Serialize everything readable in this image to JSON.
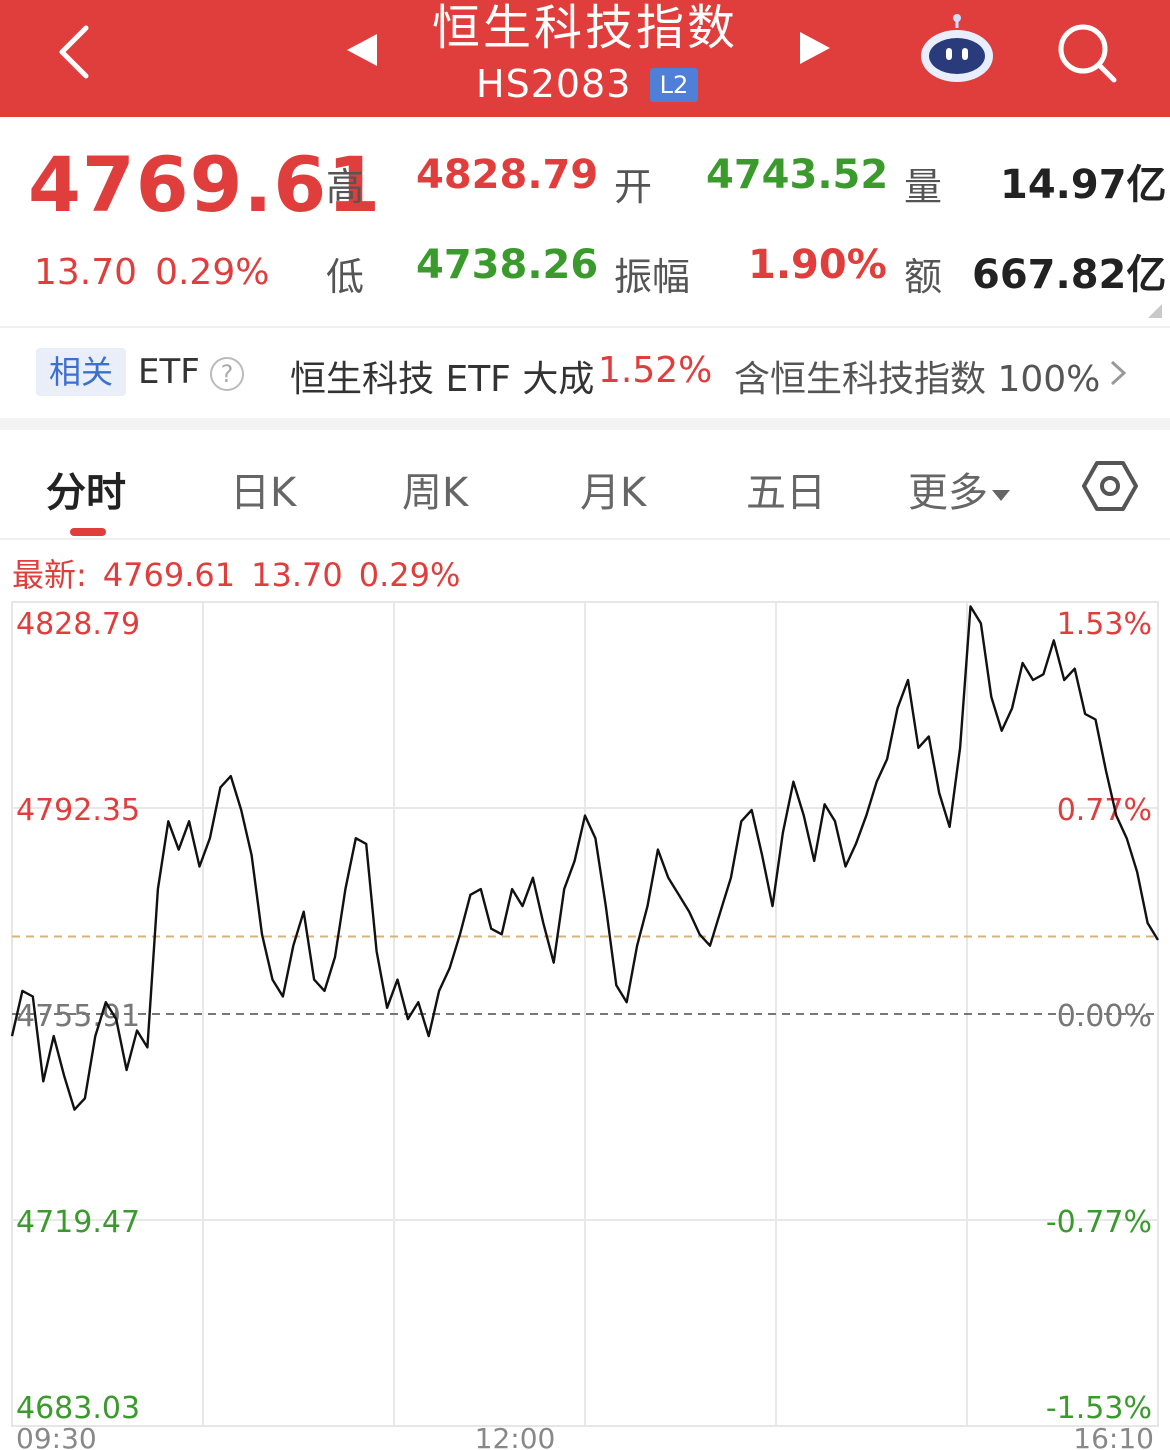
{
  "header": {
    "title": "恒生科技指数",
    "code": "HS2083",
    "level_badge": "L2"
  },
  "quote": {
    "last": "4769.61",
    "change": "13.70",
    "change_pct": "0.29%",
    "high_label": "高",
    "high": "4828.79",
    "low_label": "低",
    "low": "4738.26",
    "open_label": "开",
    "open": "4743.52",
    "amplitude_label": "振幅",
    "amplitude": "1.90%",
    "volume_label": "量",
    "volume": "14.97亿",
    "turnover_label": "额",
    "turnover": "667.82亿"
  },
  "etf": {
    "tag": "相关",
    "label": "ETF",
    "help": "?",
    "name": "恒生科技 ETF 大成",
    "pct": "1.52%",
    "contains": "含恒生科技指数 100%"
  },
  "tabs": [
    {
      "label": "分时",
      "active": true
    },
    {
      "label": "日K"
    },
    {
      "label": "周K"
    },
    {
      "label": "月K"
    },
    {
      "label": "五日"
    },
    {
      "label": "更多"
    }
  ],
  "latest_line": {
    "label": "最新:",
    "price": "4769.61",
    "change": "13.70",
    "pct": "0.29%"
  },
  "colors": {
    "up": "#e03e3c",
    "down": "#3a9a2c",
    "header_bg": "#e03e3c",
    "line": "#111111"
  },
  "chart_data": {
    "type": "line",
    "title": "",
    "xlabel": "",
    "ylabel": "",
    "prev_close": 4755.91,
    "ylim": [
      4683.03,
      4828.79
    ],
    "y_ticks_left": [
      "4828.79",
      "4792.35",
      "4755.91",
      "4719.47",
      "4683.03"
    ],
    "y_ticks_right": [
      "1.53%",
      "0.77%",
      "0.00%",
      "-0.77%",
      "-1.53%"
    ],
    "x_ticks": [
      "09:30",
      "12:00",
      "16:10"
    ],
    "grid": true,
    "reference_line": 4769.61,
    "series": [
      {
        "x": [
          0,
          3,
          6,
          9,
          12,
          15,
          18,
          21,
          24,
          27,
          30,
          33,
          36,
          39,
          42,
          45,
          48,
          51,
          54,
          57,
          60,
          63,
          66,
          69,
          72,
          75,
          78,
          81,
          84,
          87,
          90,
          93,
          96,
          99,
          102,
          105,
          108,
          111,
          114,
          117,
          120,
          123,
          126,
          129,
          132,
          135,
          138,
          141,
          144,
          147,
          150,
          153,
          156,
          159,
          162,
          165,
          168,
          171,
          174,
          177,
          180,
          183,
          186,
          189,
          192,
          195,
          198,
          201,
          204,
          207,
          210,
          213,
          216,
          219,
          222,
          225,
          228,
          231,
          234,
          237,
          240,
          243,
          246,
          249,
          252,
          255,
          258,
          261,
          264,
          267,
          270,
          273,
          276,
          279,
          282,
          285,
          288,
          291,
          294,
          297,
          300,
          303,
          306,
          309,
          312,
          315,
          318,
          321,
          324,
          327,
          330
        ],
        "values": [
          4752.0,
          4760.0,
          4759.0,
          4744.0,
          4752.0,
          4745.0,
          4739.0,
          4741.0,
          4752.0,
          4758.0,
          4755.0,
          4746.0,
          4753.0,
          4750.0,
          4778.0,
          4790.0,
          4785.0,
          4790.0,
          4782.0,
          4787.0,
          4796.0,
          4798.0,
          4792.0,
          4784.0,
          4770.0,
          4762.0,
          4759.0,
          4768.0,
          4774.0,
          4762.0,
          4760.0,
          4766.0,
          4778.0,
          4787.0,
          4786.0,
          4767.0,
          4757.0,
          4762.0,
          4755.0,
          4758.0,
          4752.0,
          4760.0,
          4764.0,
          4770.0,
          4777.0,
          4778.0,
          4771.0,
          4770.0,
          4778.0,
          4775.0,
          4780.0,
          4772.0,
          4765.0,
          4778.0,
          4783.0,
          4791.0,
          4787.0,
          4775.0,
          4761.0,
          4758.0,
          4768.0,
          4775.0,
          4785.0,
          4780.0,
          4777.0,
          4774.0,
          4770.0,
          4768.0,
          4774.0,
          4780.0,
          4790.0,
          4792.0,
          4784.0,
          4775.0,
          4788.0,
          4797.0,
          4791.0,
          4783.0,
          4793.0,
          4790.0,
          4782.0,
          4786.0,
          4791.0,
          4797.0,
          4801.0,
          4810.0,
          4815.0,
          4803.0,
          4805.0,
          4795.0,
          4789.0,
          4803.0,
          4828.0,
          4825.0,
          4812.0,
          4806.0,
          4810.0,
          4818.0,
          4815.0,
          4816.0,
          4822.0,
          4815.0,
          4817.0,
          4809.0,
          4808.0,
          4799.0,
          4791.0,
          4787.0,
          4781.0,
          4772.0,
          4769.0
        ]
      }
    ]
  }
}
